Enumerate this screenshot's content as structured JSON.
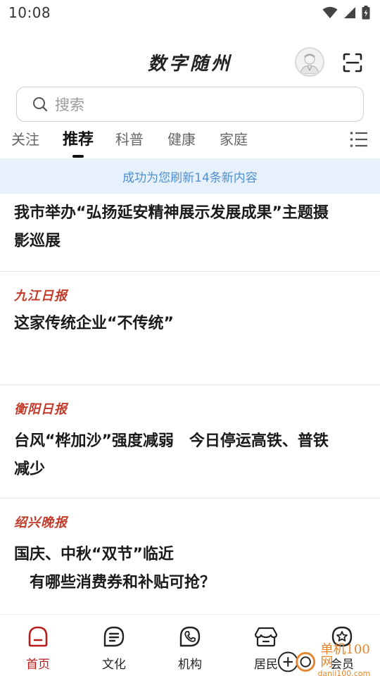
{
  "status_bar": {
    "time": "10:08"
  },
  "header": {
    "title": "数字随州"
  },
  "search": {
    "placeholder": "搜索"
  },
  "tabs": [
    {
      "label": "关注",
      "active": false
    },
    {
      "label": "推荐",
      "active": true
    },
    {
      "label": "科普",
      "active": false
    },
    {
      "label": "健康",
      "active": false
    },
    {
      "label": "家庭",
      "active": false
    }
  ],
  "refresh_notice": "成功为您刷新14条新内容",
  "articles": [
    {
      "source": "",
      "title_lines": [
        "我市举办“弘扬延安精神展示发展成果”主题摄",
        "影巡展"
      ]
    },
    {
      "source": "九江日报",
      "title_lines": [
        "这家传统企业“不传统”"
      ]
    },
    {
      "source": "衡阳日报",
      "title_lines": [
        "台风“桦加沙”强度减弱　今日停运高铁、普铁",
        "减少"
      ]
    },
    {
      "source": "绍兴晚报",
      "title_lines": [
        "国庆、中秋“双节”临近",
        "　有哪些消费券和补贴可抢？"
      ]
    }
  ],
  "bottom_nav": [
    {
      "label": "首页",
      "icon": "home-icon",
      "active": true
    },
    {
      "label": "文化",
      "icon": "culture-icon",
      "active": false
    },
    {
      "label": "机构",
      "icon": "phone-icon",
      "active": false
    },
    {
      "label": "居民",
      "icon": "residents-icon",
      "active": false
    },
    {
      "label": "会员",
      "icon": "member-icon",
      "active": false
    }
  ],
  "watermark": {
    "text": "单机100网",
    "sub": "danji100.com"
  },
  "colors": {
    "accent_red": "#b71c1c",
    "source_red": "#c23b2a",
    "banner_bg": "#e7f1fb",
    "banner_text": "#4f8fd1"
  }
}
